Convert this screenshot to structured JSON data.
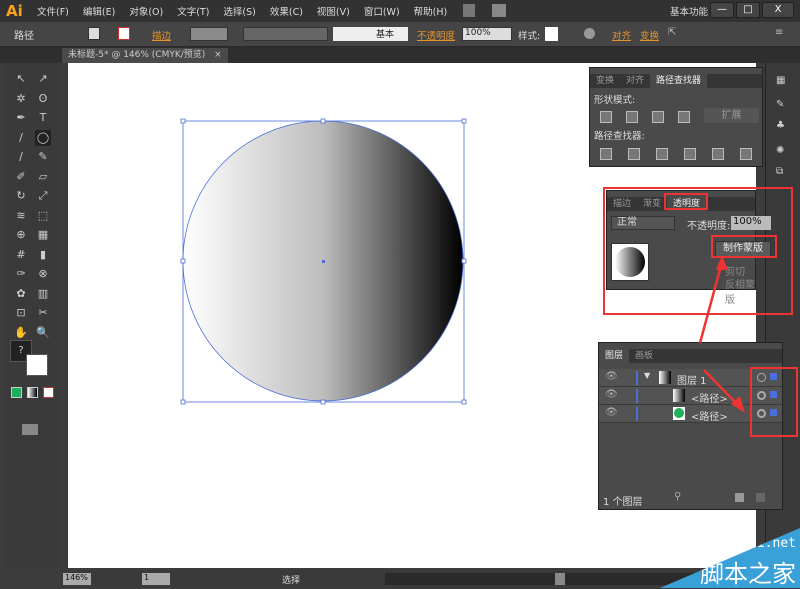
{
  "app": {
    "logo": "Ai",
    "workspace": "基本功能",
    "window_buttons": [
      "—",
      "□",
      "X"
    ]
  },
  "menu": [
    "文件(F)",
    "编辑(E)",
    "对象(O)",
    "文字(T)",
    "选择(S)",
    "效果(C)",
    "视图(V)",
    "窗口(W)",
    "帮助(H)"
  ],
  "control": {
    "selection": "路径",
    "stroke_label": "描边",
    "brush": "基本",
    "opacity_label": "不透明度",
    "opacity": "100%",
    "style_label": "样式:",
    "align": "对齐",
    "transform": "变换"
  },
  "doc_tab": {
    "title": "未标题-5* @ 146% (CMYK/预览)",
    "close": "×"
  },
  "pathfinder": {
    "tabs": [
      "变换",
      "对齐",
      "路径查找器"
    ],
    "shape_modes": "形状模式:",
    "expand": "扩展",
    "pathfinders": "路径查找器:"
  },
  "transparency": {
    "tabs": [
      "描边",
      "渐变",
      "透明度"
    ],
    "blend": "正常",
    "opacity_label": "不透明度:",
    "opacity": "100%",
    "make_mask": "制作蒙版",
    "clip": "剪切",
    "invert": "反相蒙版"
  },
  "layers": {
    "tabs": [
      "图层",
      "画板"
    ],
    "rows": [
      {
        "name": "图层 1",
        "type": "layer"
      },
      {
        "name": "<路径>",
        "type": "gradient"
      },
      {
        "name": "<路径>",
        "type": "green"
      }
    ],
    "count": "1 个图层"
  },
  "status": {
    "zoom": "146%",
    "page": "1",
    "tool": "选择"
  },
  "watermark": {
    "url": "jb51.net",
    "name": "脚本之家"
  },
  "colors": {
    "accent": "#e8932c",
    "highlight": "#e33333",
    "selection": "#4a6fd8",
    "circle_fill": "#1fae5b"
  }
}
